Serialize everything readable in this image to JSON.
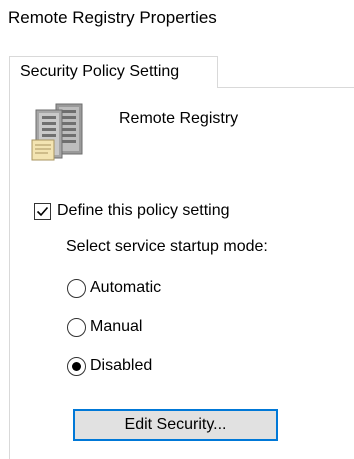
{
  "window": {
    "title": "Remote Registry Properties"
  },
  "tabs": [
    {
      "label": "Security Policy Setting",
      "active": true
    }
  ],
  "service": {
    "icon": "server-icon",
    "name": "Remote Registry"
  },
  "policy": {
    "define_label": "Define this policy setting",
    "define_checked": true,
    "mode_label": "Select service startup mode:",
    "options": [
      {
        "label": "Automatic",
        "selected": false
      },
      {
        "label": "Manual",
        "selected": false
      },
      {
        "label": "Disabled",
        "selected": true
      }
    ]
  },
  "buttons": {
    "edit_security": "Edit Security..."
  },
  "colors": {
    "focus_border": "#0078d7",
    "button_bg": "#e1e1e1",
    "tab_border": "#d9d9d9"
  }
}
